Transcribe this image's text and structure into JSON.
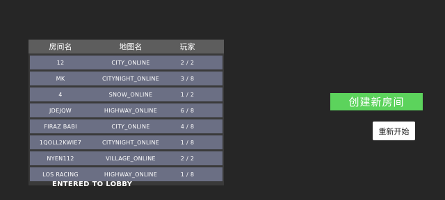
{
  "table": {
    "headers": {
      "room_name": "房间名",
      "map_name": "地图名",
      "players": "玩家"
    },
    "rows": [
      {
        "room": "12",
        "map": "CITY_ONLINE",
        "players": "2 / 2"
      },
      {
        "room": "MK",
        "map": "CITYNIGHT_ONLINE",
        "players": "3 / 8"
      },
      {
        "room": "4",
        "map": "SNOW_ONLINE",
        "players": "1 / 2"
      },
      {
        "room": "JDEJQW",
        "map": "HIGHWAY_ONLINE",
        "players": "6 / 8"
      },
      {
        "room": "FIRAZ BABI",
        "map": "CITY_ONLINE",
        "players": "4 / 8"
      },
      {
        "room": "1QOLL2KWIE7",
        "map": "CITYNIGHT_ONLINE",
        "players": "1 / 8"
      },
      {
        "room": "NYEN112",
        "map": "VILLAGE_ONLINE",
        "players": "2 / 2"
      },
      {
        "room": "LOS RACING",
        "map": "HIGHWAY_ONLINE",
        "players": "1 / 8"
      }
    ]
  },
  "status": "ENTERED TO LOBBY",
  "buttons": {
    "create_room": "创建新房间",
    "restart": "重新开始"
  }
}
